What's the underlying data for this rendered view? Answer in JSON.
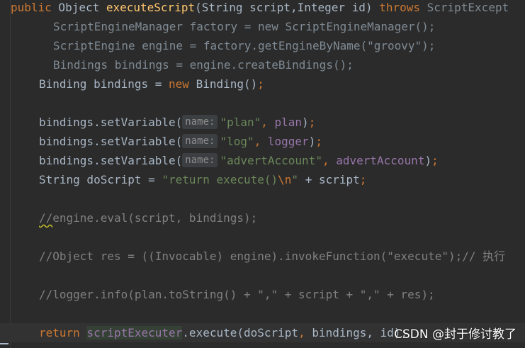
{
  "theme": {
    "background": "#2b2b2b",
    "current_line": "#323232",
    "keyword": "#cc7832",
    "method_decl": "#ffc66d",
    "string": "#6a8759",
    "field": "#9876aa",
    "comment": "#808080",
    "plain": "#a9b7c6"
  },
  "code": {
    "l1": {
      "kw_public": "public",
      "t1": " Object ",
      "fn_name": "executeScript",
      "t2": "(String script,Integer id) ",
      "kw_throws": "throws",
      "t3": " ScriptExcept"
    },
    "l2": {
      "text": "ScriptEngineManager factory = new ScriptEngineManager();"
    },
    "l3": {
      "text": "ScriptEngine engine = factory.getEngineByName(\"groovy\");"
    },
    "l4": {
      "text": "Bindings bindings = engine.createBindings();"
    },
    "l5": {
      "t1": "Binding bindings = ",
      "kw_new": "new",
      "t2": " Binding()",
      "semi": ";"
    },
    "l6": {
      "t1": "bindings.setVariable(",
      "hint": "name:",
      "str": "\"plan\"",
      "comma": ", ",
      "field": "plan",
      "t2": ")",
      "semi": ";"
    },
    "l7": {
      "t1": "bindings.setVariable(",
      "hint": "name:",
      "str": "\"log\"",
      "comma": ", ",
      "field": "logger",
      "t2": ")",
      "semi": ";"
    },
    "l8": {
      "t1": "bindings.setVariable(",
      "hint": "name:",
      "str": "\"advertAccount\"",
      "comma": ", ",
      "field": "advertAccount",
      "t2": ")",
      "semi": ";"
    },
    "l9": {
      "t1": "String doScript = ",
      "str1": "\"return execute()",
      "esc": "\\n",
      "str2": "\"",
      "t2": " + script",
      "semi": ";"
    },
    "l10": {
      "slashes": "//",
      "rest": "engine.eval(script, bindings);"
    },
    "l11": {
      "text": "//Object res = ((Invocable) engine).invokeFunction(\"execute\");// 执行"
    },
    "l12": {
      "text": "//logger.info(plan.toString() + \",\" + script + \",\" + res);"
    },
    "l13": {
      "kw_return": "return",
      "sp": " ",
      "usage": "scriptExecuter",
      "t1": ".execute(doScript",
      "comma": ", ",
      "t2": "bindings",
      "t3": ", id);"
    }
  },
  "watermark": "CSDN @封于修讨教了"
}
